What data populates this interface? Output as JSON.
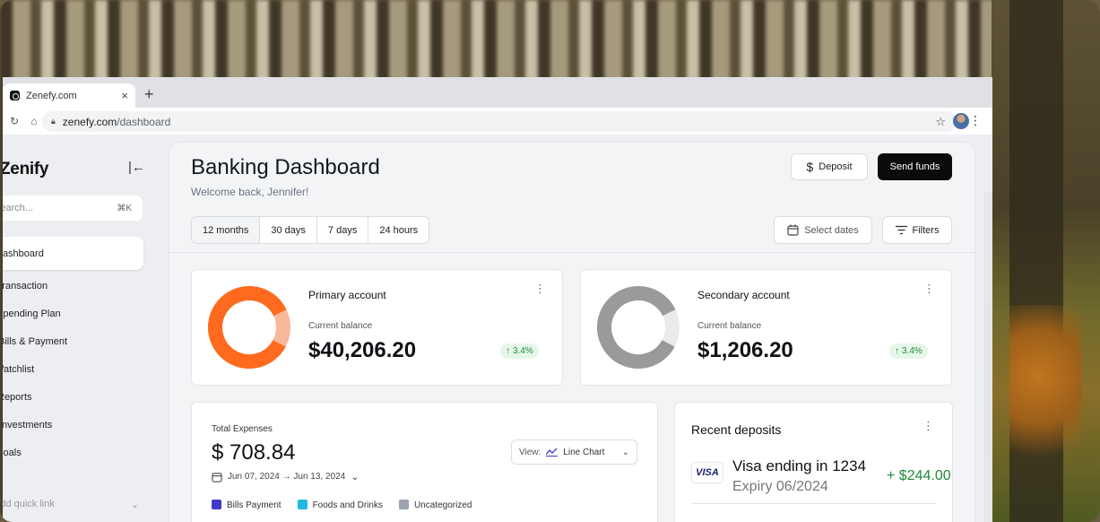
{
  "browser": {
    "tab_title": "Zenefy.com",
    "tab_close": "×",
    "new_tab": "+",
    "url_host": "zenefy.com",
    "url_path": "/dashboard"
  },
  "sidebar": {
    "brand": "Zenify",
    "search_placeholder": "Search...",
    "search_shortcut": "⌘K",
    "items": [
      {
        "label": "Dashboard"
      },
      {
        "label": "Transaction"
      },
      {
        "label": "Spending Plan"
      },
      {
        "label": "Bills & Payment"
      },
      {
        "label": "Watchlist"
      },
      {
        "label": "Reports"
      },
      {
        "label": "Investments"
      },
      {
        "label": "Goals"
      }
    ],
    "quick_link": "Add quick link"
  },
  "header": {
    "title": "Banking Dashboard",
    "welcome": "Welcome back, Jennifer!",
    "deposit_label": "Deposit",
    "send_label": "Send funds"
  },
  "filters": {
    "ranges": [
      "12 months",
      "30 days",
      "7 days",
      "24 hours"
    ],
    "active_range": "12 months",
    "select_dates": "Select dates",
    "filters_label": "Filters"
  },
  "accounts": [
    {
      "name": "Primary account",
      "sub": "Current balance",
      "balance": "$40,206.20",
      "change": "3.4%",
      "color": "#ff6a1f",
      "track": "#f8b89a",
      "fill_fraction": 0.85
    },
    {
      "name": "Secondary account",
      "sub": "Current balance",
      "balance": "$1,206.20",
      "change": "3.4%",
      "color": "#9a9a9a",
      "track": "#e8ece9",
      "fill_fraction": 0.85
    }
  ],
  "expenses": {
    "label": "Total Expenses",
    "value": "$ 708.84",
    "date_range": "Jun 07, 2024 → Jun 13, 2024",
    "view_prefix": "View:",
    "view_value": "Line Chart",
    "legend": [
      {
        "label": "Bills Payment",
        "color": "#4338ca"
      },
      {
        "label": "Foods and Drinks",
        "color": "#22b8e0"
      },
      {
        "label": "Uncategorized",
        "color": "#9ca3af"
      }
    ]
  },
  "deposits": {
    "title": "Recent deposits",
    "items": [
      {
        "brand": "VISA",
        "name": "Visa ending in 1234",
        "expiry": "Expiry 06/2024",
        "amount": "+ $244.00"
      }
    ]
  }
}
